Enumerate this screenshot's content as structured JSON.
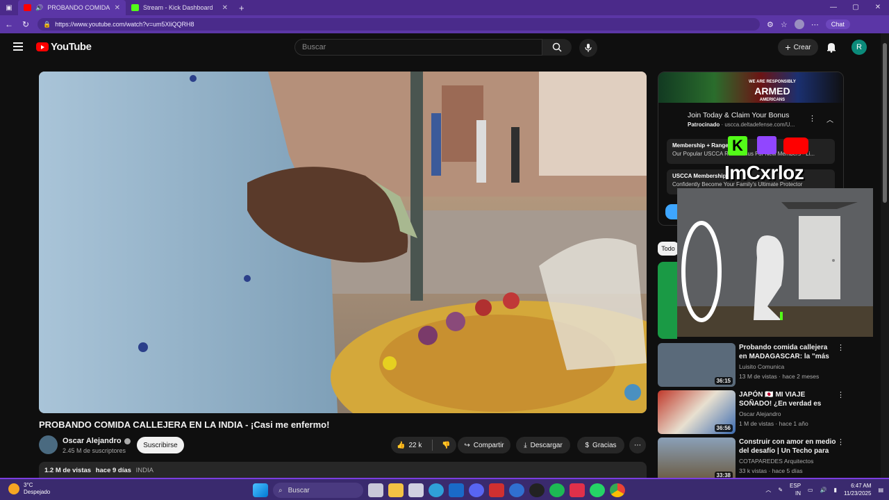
{
  "browser": {
    "tabs": [
      {
        "title": "PROBANDO COMIDA CALLE",
        "active": true
      },
      {
        "title": "Stream - Kick Dashboard",
        "active": false
      }
    ],
    "url": "https://www.youtube.com/watch?v=um5XliQQRH8",
    "chat_label": "Chat"
  },
  "header": {
    "logo": "YouTube",
    "search_placeholder": "Buscar",
    "create_label": "Crear",
    "avatar_letter": "R"
  },
  "video": {
    "title": "PROBANDO COMIDA CALLEJERA EN LA INDIA - ¡Casi me enfermo!",
    "channel": "Oscar Alejandro",
    "subscribers": "2.45 M de suscriptores",
    "subscribe_label": "Suscribirse",
    "likes": "22 k",
    "share_label": "Compartir",
    "download_label": "Descargar",
    "thanks_label": "Gracias",
    "views": "1.2 M de vistas",
    "age": "hace 9 días",
    "tag": "INDIA"
  },
  "ad": {
    "banner_small": "WE ARE RESPONSIBLY",
    "banner_big": "ARMED",
    "banner_sub": "AMERICANS",
    "title": "Join Today & Claim Your Bonus",
    "sponsor_label": "Patrocinado",
    "sponsor_domain": "uscca.deltadefense.com/U...",
    "items": [
      {
        "title": "Membership + Range B...",
        "sub": "Our Popular USCCA Ra... Bonus For New Members - Li..."
      },
      {
        "title": "USCCA Membership",
        "sub": "Confidently Become Your Family's Ultimate Protector"
      }
    ]
  },
  "overlay": {
    "name": "ImCxrloz",
    "kick_letter": "K"
  },
  "chips": {
    "first": "Todo"
  },
  "recommendations": [
    {
      "title": "Probando comida callejera en MADAGASCAR: la \"más barata...",
      "channel": "Luisito Comunica",
      "meta": "13 M de vistas · hace 2 meses",
      "duration": "36:15",
      "color": "#5a6a7a"
    },
    {
      "title": "JAPÓN 🇯🇵 MI VIAJE SOÑADO! ¿En verdad es todo lo que ...",
      "channel": "Oscar Alejandro",
      "meta": "1 M de vistas · hace 1 año",
      "duration": "36:56",
      "color": "#b83a3a"
    },
    {
      "title": "Construir con amor en medio del desafío | Un Techo para ...",
      "channel": "COTAPAREDES Arquitectos",
      "meta": "33 k vistas · hace 5 días",
      "duration": "33:38",
      "color": "#6b5a40"
    }
  ],
  "taskbar": {
    "temp": "3°C",
    "weather": "Despejado",
    "search": "Buscar",
    "lang": "ESP",
    "lang_sub": "IN",
    "time": "6:47 AM",
    "date": "11/23/2025"
  }
}
